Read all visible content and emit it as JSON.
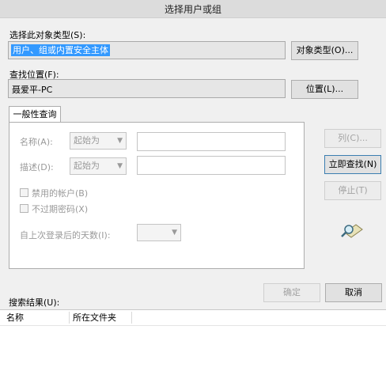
{
  "window": {
    "title": "选择用户或组"
  },
  "object_type": {
    "label": "选择此对象类型(S):",
    "value": "用户、组或内置安全主体",
    "button": "对象类型(O)..."
  },
  "location": {
    "label": "查找位置(F):",
    "value": "聂爱平-PC",
    "button": "位置(L)..."
  },
  "tab": {
    "label": "一般性查询"
  },
  "query": {
    "name_label": "名称(A):",
    "name_mode": "起始为",
    "desc_label": "描述(D):",
    "desc_mode": "起始为",
    "disabled_accounts": "禁用的帐户(B)",
    "non_expiring": "不过期密码(X)",
    "days_label": "自上次登录后的天数(I):"
  },
  "buttons": {
    "columns": "列(C)...",
    "find_now": "立即查找(N)",
    "stop": "停止(T)",
    "ok": "确定",
    "cancel": "取消"
  },
  "results": {
    "label": "搜索结果(U):",
    "columns": [
      "名称",
      "所在文件夹"
    ]
  }
}
